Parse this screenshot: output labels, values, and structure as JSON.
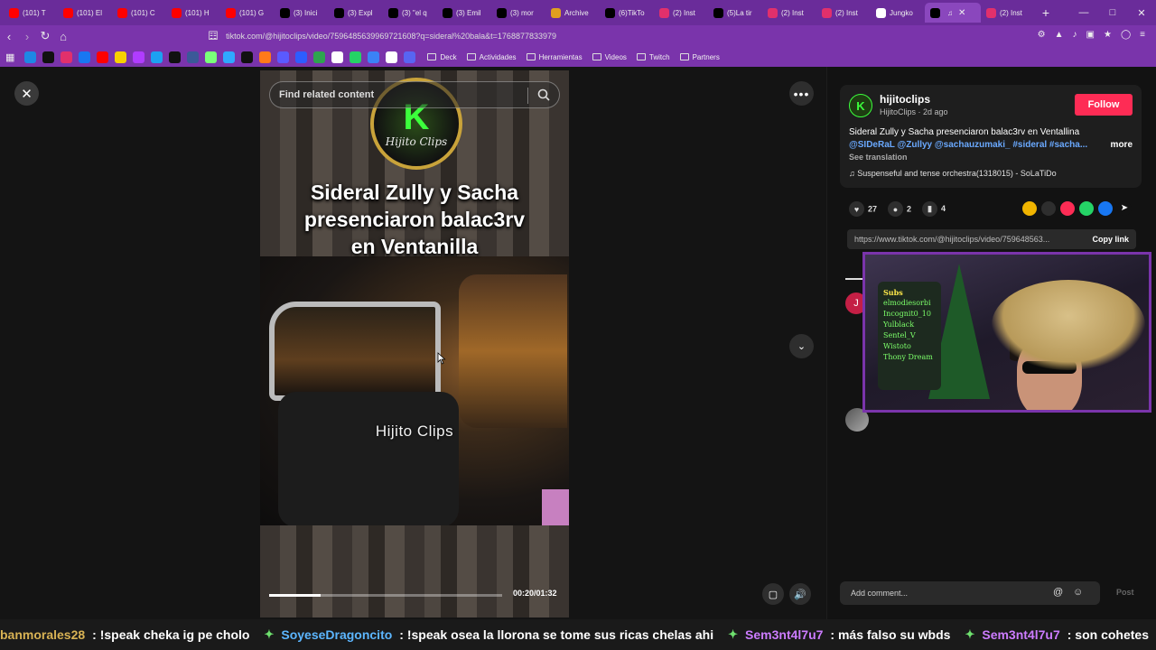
{
  "tabs": [
    {
      "label": "(101) T",
      "icon": "youtube-icon",
      "color": "#ff0000"
    },
    {
      "label": "(101) El",
      "icon": "youtube-icon",
      "color": "#ff0000"
    },
    {
      "label": "(101) C",
      "icon": "youtube-icon",
      "color": "#ff0000"
    },
    {
      "label": "(101) H",
      "icon": "youtube-icon",
      "color": "#ff0000"
    },
    {
      "label": "(101) G",
      "icon": "youtube-icon",
      "color": "#ff0000"
    },
    {
      "label": "(3) Inici",
      "icon": "x-icon",
      "color": "#000000"
    },
    {
      "label": "(3) Expl",
      "icon": "x-icon",
      "color": "#000000"
    },
    {
      "label": "(3) \"el q",
      "icon": "x-icon",
      "color": "#000000"
    },
    {
      "label": "(3) Emil",
      "icon": "x-icon",
      "color": "#000000"
    },
    {
      "label": "(3) mor",
      "icon": "x-icon",
      "color": "#000000"
    },
    {
      "label": "Archive",
      "icon": "archive-icon",
      "color": "#e0a020"
    },
    {
      "label": "(6)TikTo",
      "icon": "tiktok-icon",
      "color": "#000000"
    },
    {
      "label": "(2) Inst",
      "icon": "instagram-icon",
      "color": "#e1306c"
    },
    {
      "label": "(5)La tir",
      "icon": "tiktok-icon",
      "color": "#000000"
    },
    {
      "label": "(2) Inst",
      "icon": "instagram-icon",
      "color": "#e1306c"
    },
    {
      "label": "(2) Inst",
      "icon": "instagram-icon",
      "color": "#e1306c"
    },
    {
      "label": "Jungko",
      "icon": "google-icon",
      "color": "#ffffff"
    },
    {
      "label": "",
      "icon": "tiktok-icon",
      "color": "#000000",
      "active": true
    },
    {
      "label": "(2) Inst",
      "icon": "instagram-icon",
      "color": "#e1306c"
    }
  ],
  "address": {
    "url": "tiktok.com/@hijitoclips/video/7596485639969721608?q=sideral%20bala&t=1768877833979"
  },
  "bookmarks": {
    "folders": [
      "Deck",
      "Actividades",
      "Herramientas",
      "Videos",
      "Twitch",
      "Partners"
    ]
  },
  "video": {
    "search_placeholder": "Find related content",
    "logo_letter": "K",
    "logo_text": "Hijito Clips",
    "caption_line1": "Sideral Zully y Sacha",
    "caption_line2": "presenciaron balac3rv",
    "caption_line3": "en Ventanilla",
    "watermark": "Hijito Clips",
    "time": "00:20/01:32",
    "progress_fraction": 0.22
  },
  "panel": {
    "author": "hijitoclips",
    "author_meta": "HijitoClips · 2d ago",
    "follow_label": "Follow",
    "description": "Sideral Zully y Sacha presenciaron balac3rv en Ventallina",
    "tags": "@SIDeRaL @Zullyy @sachauzumaki_ #sideral #sacha...",
    "more_label": "more",
    "translate_label": "See translation",
    "music": "Suspenseful and tense orchestra(1318015) - SoLaTiDo",
    "likes": "27",
    "comments": "2",
    "saves": "4",
    "link": "https://www.tiktok.com/@hijitoclips/video/759648563...",
    "copy_label": "Copy link",
    "comment_avatar_letter": "J",
    "comment_placeholder": "Add comment...",
    "post_label": "Post"
  },
  "webcam": {
    "board_title": "Subs",
    "board_names": [
      "elmodiesorbi",
      "Incognit0_10",
      "Yulblack",
      "Sentel_V",
      "Wistoto",
      "Thony Dream"
    ]
  },
  "chat": [
    {
      "user": "banmorales28",
      "message": ": !speak cheka ig pe cholo",
      "style": "user"
    },
    {
      "user": "SoyeseDragoncito",
      "message": ": !speak osea la llorona se tome sus ricas chelas ahi",
      "style": "user2"
    },
    {
      "user": "Sem3nt4l7u7",
      "message": ": más falso su wbds",
      "style": "user3"
    },
    {
      "user": "Sem3nt4l7u7",
      "message": ": son cohetes",
      "style": "user3"
    }
  ]
}
